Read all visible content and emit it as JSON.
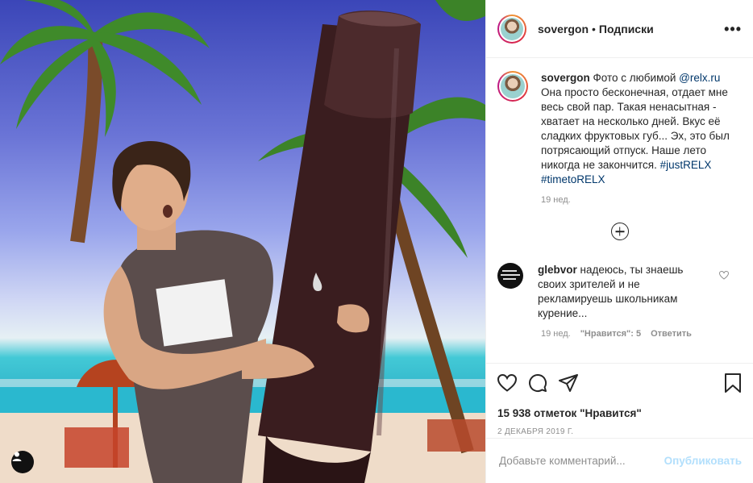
{
  "post": {
    "username": "sovergon",
    "separator": "•",
    "follow_label": "Подписки",
    "more_icon": "more-horizontal-icon"
  },
  "caption": {
    "username": "sovergon",
    "text_lead": "Фото с любимой ",
    "mention": "@relx.ru",
    "text_body": " Она просто бесконечная, отдает мне весь свой пар. Такая ненасытная - хватает на несколько дней. Вкус её сладких фруктовых губ... Эх, это был потрясающий отпуск. Наше лето никогда не закончится. ",
    "hashtag1": "#justRELX",
    "hashtag2": "#timetoRELX",
    "age": "19 нед."
  },
  "comment": {
    "username": "glebvor",
    "text": "надеюсь, ты знаешь своих зрителей и не рекламируешь школьникам курение...",
    "age": "19 нед.",
    "likes": "\"Нравится\": 5",
    "reply": "Ответить"
  },
  "stats": {
    "likes": "15 938 отметок \"Нравится\"",
    "date": "2 ДЕКАБРЯ 2019 Г."
  },
  "add_comment": {
    "placeholder": "Добавьте комментарий...",
    "post_label": "Опубликовать"
  },
  "colors": {
    "link": "#00376b",
    "muted": "#8e8e8e",
    "post_button": "#b2dffc"
  }
}
